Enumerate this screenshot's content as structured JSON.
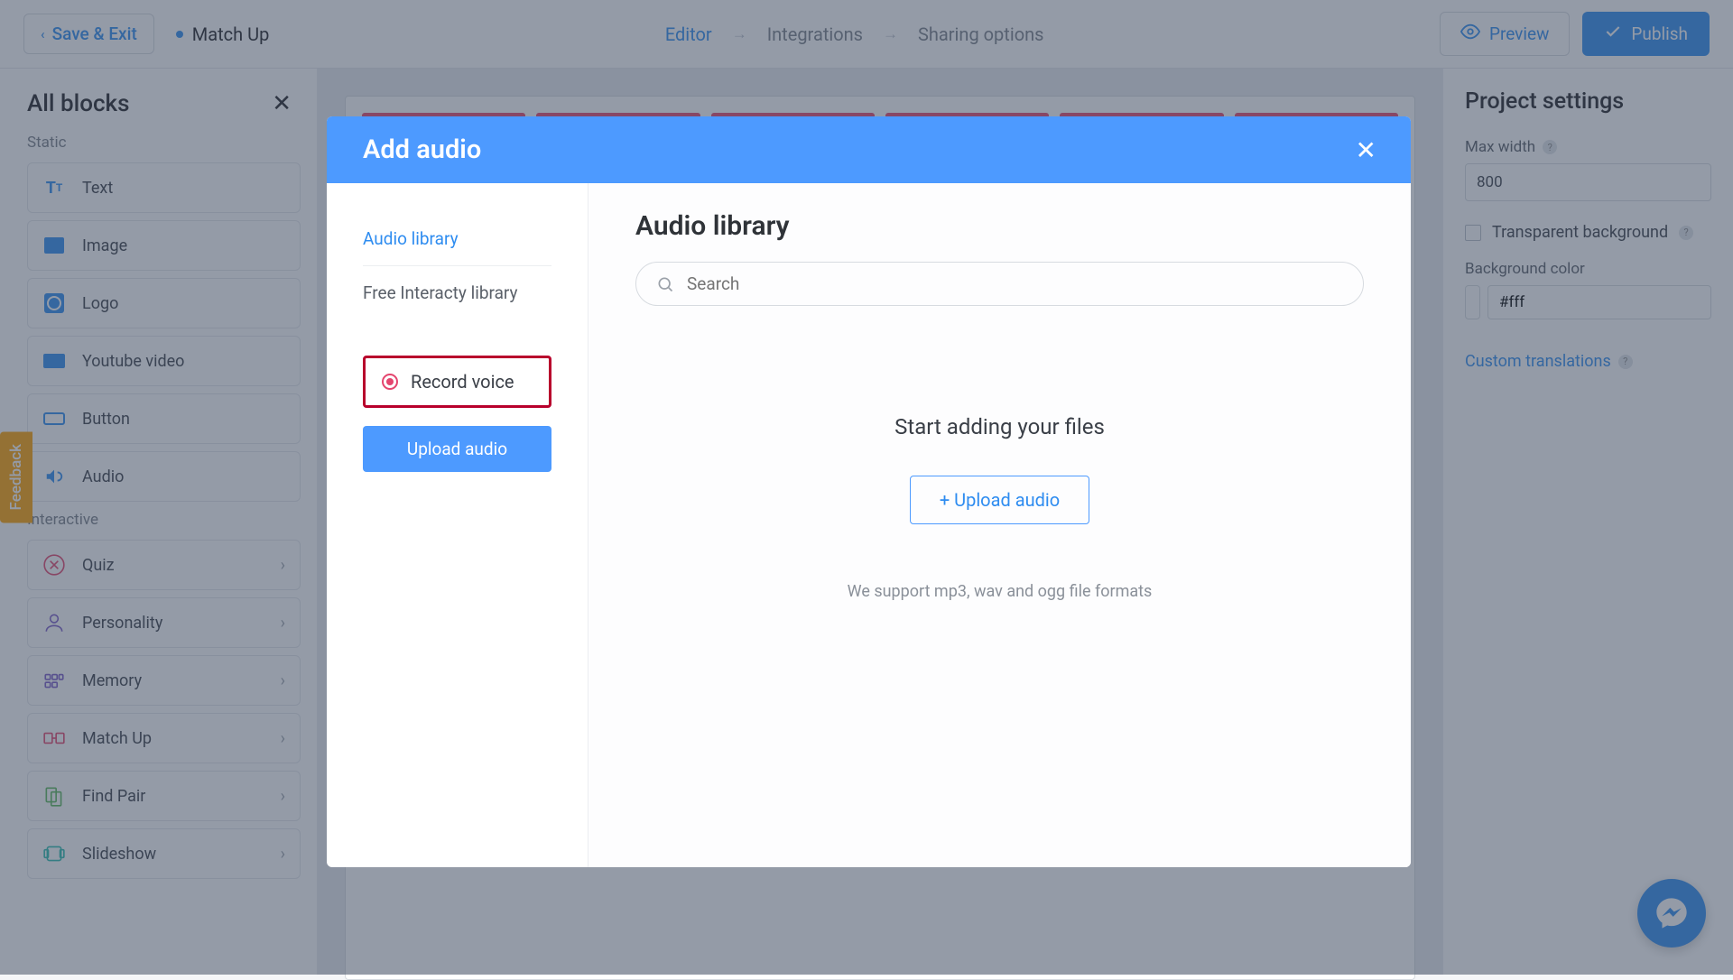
{
  "topbar": {
    "save_exit": "Save & Exit",
    "project_name": "Match Up",
    "steps": {
      "editor": "Editor",
      "integrations": "Integrations",
      "sharing": "Sharing options"
    },
    "preview": "Preview",
    "publish": "Publish"
  },
  "left_panel": {
    "title": "All blocks",
    "section_static": "Static",
    "section_interactive": "Interactive",
    "static_items": [
      "Text",
      "Image",
      "Logo",
      "Youtube video",
      "Button",
      "Audio"
    ],
    "interactive_items": [
      "Quiz",
      "Personality",
      "Memory",
      "Match Up",
      "Find Pair",
      "Slideshow"
    ]
  },
  "right_panel": {
    "title": "Project settings",
    "max_width_label": "Max width",
    "max_width_value": "800",
    "transparent_label": "Transparent background",
    "bg_label": "Background color",
    "bg_value": "#fff",
    "custom_translations": "Custom translations"
  },
  "feedback": "Feedback",
  "modal": {
    "title": "Add audio",
    "side": {
      "audio_library": "Audio library",
      "free_library": "Free Interacty library",
      "record": "Record voice",
      "upload": "Upload audio"
    },
    "main": {
      "title": "Audio library",
      "search_placeholder": "Search",
      "empty_title": "Start adding your files",
      "upload_btn": "+ Upload audio",
      "formats": "We support mp3, wav and ogg file formats"
    }
  }
}
